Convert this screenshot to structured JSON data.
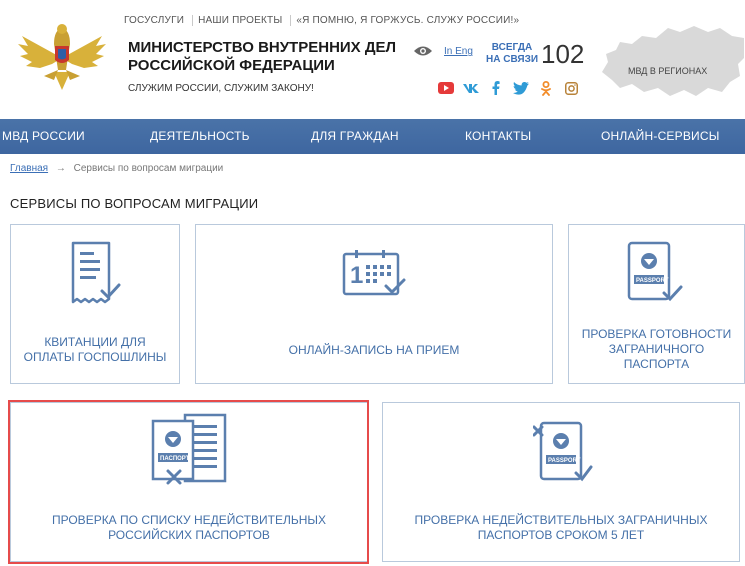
{
  "top_links": [
    "ГОСУСЛУГИ",
    "НАШИ ПРОЕКТЫ",
    "«Я ПОМНЮ, Я ГОРЖУСЬ. СЛУЖУ РОССИИ!»"
  ],
  "header": {
    "title_line1": "МИНИСТЕРСТВО ВНУТРЕННИХ ДЕЛ",
    "title_line2": "РОССИЙСКОЙ ФЕДЕРАЦИИ",
    "subtitle": "СЛУЖИМ РОССИИ, СЛУЖИМ ЗАКОНУ!",
    "lang_link": "In Eng",
    "hotline_line1": "ВСЕГДА",
    "hotline_line2": "НА СВЯЗИ",
    "hotline_number": "102",
    "regions_label": "МВД В РЕГИОНАХ"
  },
  "socials": [
    "youtube-icon",
    "vk-icon",
    "facebook-icon",
    "twitter-icon",
    "odnoklassniki-icon",
    "instagram-icon"
  ],
  "nav": [
    "МВД РОССИИ",
    "ДЕЯТЕЛЬНОСТЬ",
    "ДЛЯ ГРАЖДАН",
    "КОНТАКТЫ",
    "ОНЛАЙН-СЕРВИСЫ"
  ],
  "breadcrumb": {
    "home": "Главная",
    "separator": "→",
    "current": "Сервисы по вопросам миграции"
  },
  "page_title": "СЕРВИСЫ ПО ВОПРОСАМ МИГРАЦИИ",
  "services": [
    {
      "line1": "КВИТАНЦИИ ДЛЯ",
      "line2": "ОПЛАТЫ ГОСПОШЛИНЫ",
      "icon": "receipt-icon"
    },
    {
      "line1": "ОНЛАЙН-ЗАПИСЬ НА ПРИЕМ",
      "icon": "calendar-icon"
    },
    {
      "line1": "ПРОВЕРКА ГОТОВНОСТИ",
      "line2": "ЗАГРАНИЧНОГО",
      "line3": "ПАСПОРТА",
      "icon": "passport-check-icon",
      "icon_text": "PASSPORT"
    },
    {
      "line1": "ПРОВЕРКА ПО СПИСКУ НЕДЕЙСТВИТЕЛЬНЫХ",
      "line2": "РОССИЙСКИХ ПАСПОРТОВ",
      "icon": "invalid-passport-icon",
      "icon_text": "ПАСПОРТ"
    },
    {
      "line1": "ПРОВЕРКА НЕДЕЙСТВИТЕЛЬНЫХ ЗАГРАНИЧНЫХ",
      "line2": "ПАСПОРТОВ СРОКОМ 5 ЛЕТ",
      "icon": "invalid-foreign-passport-icon",
      "icon_text": "PASSPORT"
    }
  ],
  "colors": {
    "nav_bg": "#4470a8",
    "accent": "#3b6fb6",
    "icon_blue": "#5b7fae",
    "highlight": "#e64b4b"
  }
}
